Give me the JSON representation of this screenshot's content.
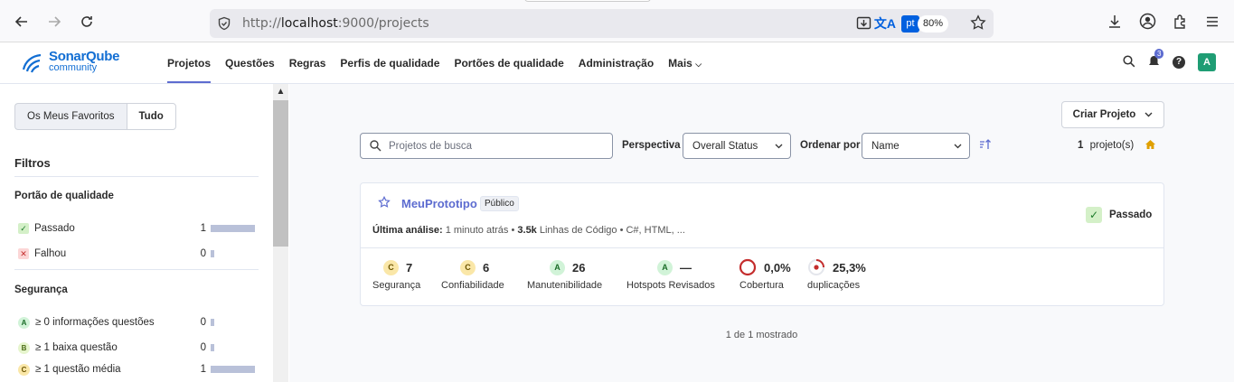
{
  "browser": {
    "url_prefix": "http://",
    "url_host": "localhost",
    "url_rest": ":9000/projects",
    "lang_badge": "pt",
    "zoom": "80%"
  },
  "brand": {
    "name": "SonarQube",
    "edition": "community"
  },
  "nav": {
    "items": [
      "Projetos",
      "Questões",
      "Regras",
      "Perfis de qualidade",
      "Portões de qualidade",
      "Administração",
      "Mais"
    ],
    "active": "Projetos",
    "notification_count": "3",
    "avatar_initial": "A"
  },
  "sidebar": {
    "toggle": [
      "Os Meus Favoritos",
      "Tudo"
    ],
    "filters_title": "Filtros",
    "quality_gate": {
      "title": "Portão de qualidade",
      "rows": [
        {
          "label": "Passado",
          "count": "1",
          "fraction": 1.0
        },
        {
          "label": "Falhou",
          "count": "0",
          "fraction": 0.0
        }
      ]
    },
    "security": {
      "title": "Segurança",
      "rows": [
        {
          "rating": "A",
          "label": "≥ 0 informações questões",
          "count": "0",
          "fraction": 0.0
        },
        {
          "rating": "B",
          "label": "≥ 1 baixa questão",
          "count": "0",
          "fraction": 0.0
        },
        {
          "rating": "C",
          "label": "≥ 1 questão média",
          "count": "1",
          "fraction": 1.0
        }
      ]
    }
  },
  "toolbar": {
    "create_button": "Criar Projeto",
    "search_placeholder": "Projetos de busca",
    "perspective_label": "Perspectiva",
    "perspective_value": "Overall Status",
    "sort_label": "Ordenar por",
    "sort_value": "Name",
    "count_value": "1",
    "count_label": "projeto(s)"
  },
  "project": {
    "name": "MeuPrototipo",
    "visibility": "Público",
    "last_analysis_label": "Última análise:",
    "last_analysis_value": "1 minuto atrás",
    "lines": "3.5k",
    "lines_label": "Linhas de Código",
    "languages": "C#, HTML, ...",
    "gate_status": "Passado",
    "metrics": [
      {
        "rating": "C",
        "value": "7",
        "name": "Segurança"
      },
      {
        "rating": "C",
        "value": "6",
        "name": "Confiabilidade"
      },
      {
        "rating": "A",
        "value": "26",
        "name": "Manutenibilidade"
      },
      {
        "rating": "A",
        "value": "—",
        "name": "Hotspots Revisados"
      },
      {
        "value": "0,0%",
        "name": "Cobertura",
        "percent": 0.0
      },
      {
        "value": "25,3%",
        "name": "duplicações",
        "percent": 25.3
      }
    ]
  },
  "footer": "1 de 1 mostrado"
}
